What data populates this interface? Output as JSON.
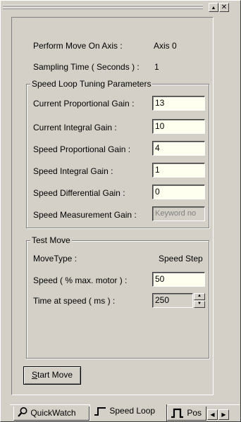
{
  "title_bar": {
    "restore_glyph": "▲",
    "close_glyph": "✕"
  },
  "info": {
    "axis_label": "Perform Move On Axis :",
    "axis_value": "Axis 0",
    "sampling_label": "Sampling Time ( Seconds ) :",
    "sampling_value": "1"
  },
  "speed_loop": {
    "title": "Speed Loop Tuning Parameters",
    "params": [
      {
        "label": "Current Proportional Gain :",
        "value": "13"
      },
      {
        "label": "Current Integral Gain :",
        "value": "10"
      },
      {
        "label": "Speed Proportional Gain :",
        "value": "4"
      },
      {
        "label": "Speed Integral Gain :",
        "value": "1"
      },
      {
        "label": "Speed Differential Gain :",
        "value": "0"
      },
      {
        "label": "Speed Measurement Gain :",
        "value": "Keyword no"
      }
    ]
  },
  "test_move": {
    "title": "Test Move",
    "move_type_label": "MoveType :",
    "move_type_value": "Speed Step",
    "speed_label": "Speed ( % max. motor  ) :",
    "speed_value": "50",
    "time_label": "Time at speed ( ms ) :",
    "time_value": "250"
  },
  "start_button": {
    "mnemonic": "S",
    "rest": "tart Move"
  },
  "tabs": [
    {
      "label": "QuickWatch",
      "icon": "magnifier-icon"
    },
    {
      "label": "Speed Loop",
      "icon": "step-signal-icon"
    },
    {
      "label": "Pos",
      "icon": "pulse-signal-icon"
    }
  ],
  "tab_arrows": {
    "left": "◀",
    "right": "▶"
  },
  "colors": {
    "face": "#d4d0c8",
    "field_bg": "#fffff0",
    "shadow": "#808080",
    "highlight": "#ffffff"
  }
}
